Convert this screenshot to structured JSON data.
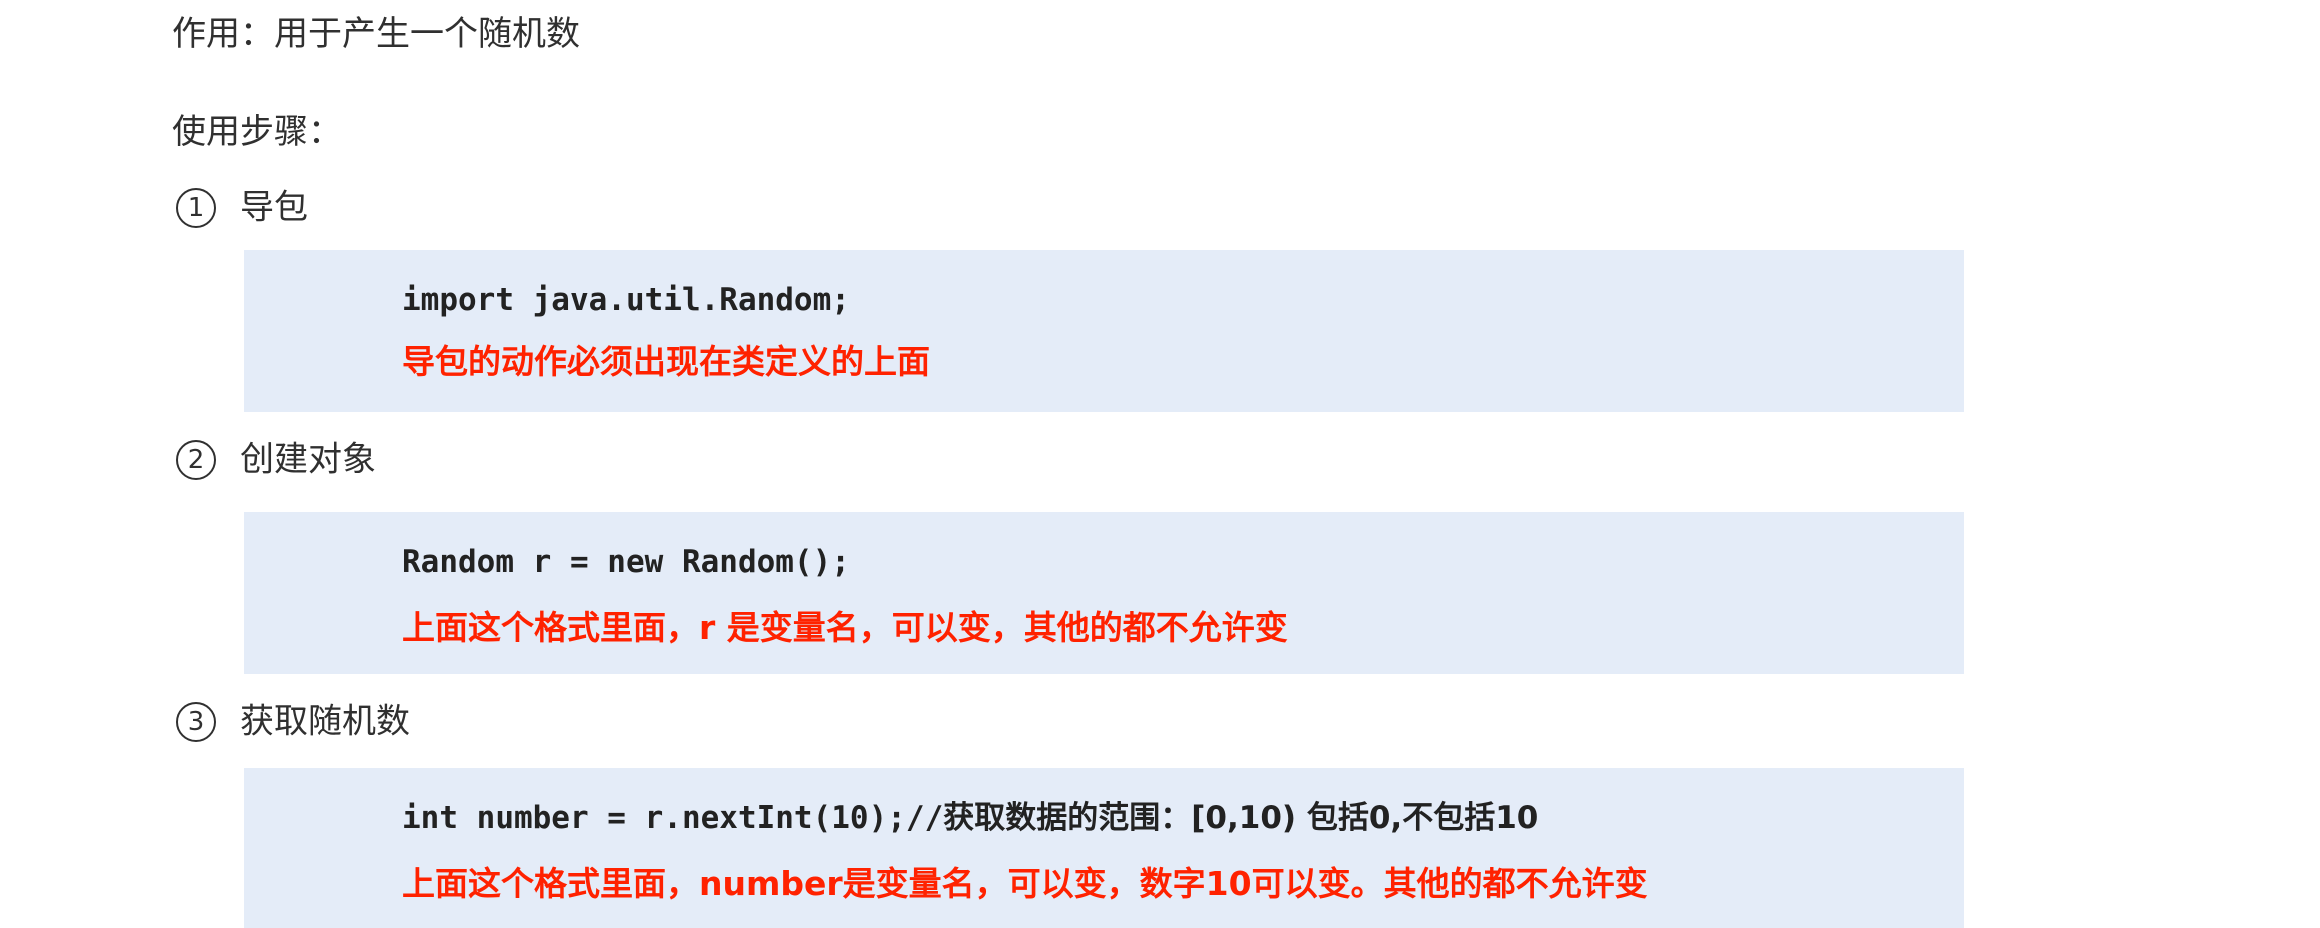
{
  "purpose": "作用：用于产生一个随机数",
  "steps_heading": "使用步骤：",
  "colors": {
    "note": "#ff2200",
    "code_bg": "#e4ecf8",
    "text": "#303030"
  },
  "steps": [
    {
      "number": "1",
      "title": "导包",
      "code": "import java.util.Random;",
      "code_comment": "",
      "note": "导包的动作必须出现在类定义的上面"
    },
    {
      "number": "2",
      "title": "创建对象",
      "code": "Random r = new Random();",
      "code_comment": "",
      "note": "上面这个格式里面，r 是变量名，可以变，其他的都不允许变"
    },
    {
      "number": "3",
      "title": "获取随机数",
      "code": "int number = r.nextInt(10);//",
      "code_comment": "获取数据的范围：[0,10) 包括0,不包括10",
      "note": "上面这个格式里面，number是变量名，可以变，数字10可以变。其他的都不允许变"
    }
  ]
}
